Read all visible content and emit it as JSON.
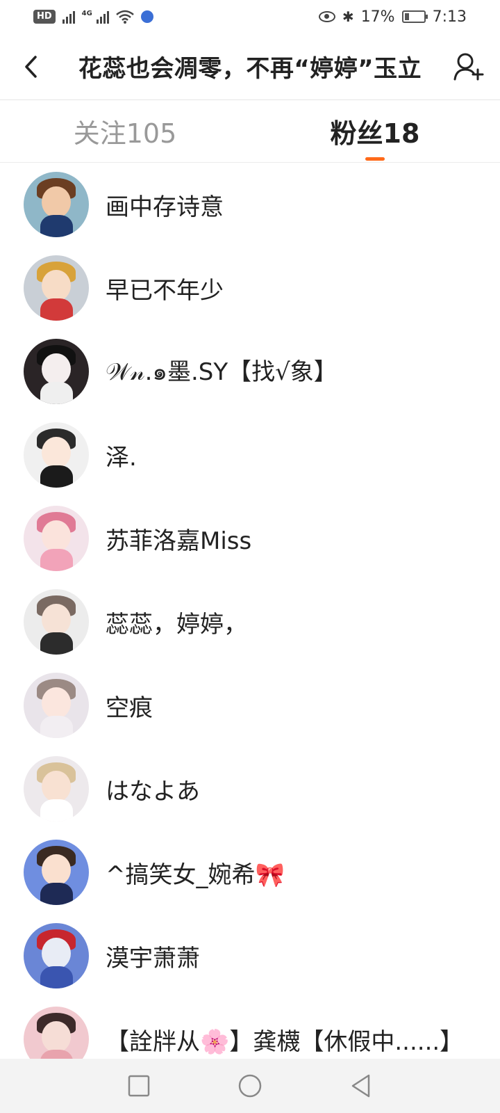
{
  "status_bar": {
    "hd_label": "HD",
    "net_label": "4G",
    "battery_percent": "17%",
    "time": "7:13"
  },
  "header": {
    "title": "花蕊也会凋零，不再“婷婷”玉立"
  },
  "tabs": [
    {
      "label": "关注105",
      "active": false
    },
    {
      "label": "粉丝18",
      "active": true
    }
  ],
  "followers": [
    {
      "name": "画中存诗意"
    },
    {
      "name": "早已不年少"
    },
    {
      "name": "𝒲𝓃.๑墨.SY【找√象】"
    },
    {
      "name": "泽."
    },
    {
      "name": "苏菲洛嘉Miss"
    },
    {
      "name": "蕊蕊，婷婷，"
    },
    {
      "name": "空痕"
    },
    {
      "name": "はなよあ"
    },
    {
      "name": "^搞笑女_婉希🎀"
    },
    {
      "name": "漠宇萧萧"
    },
    {
      "name": "【詮牉从🌸】龚櫗【休假中......】"
    }
  ],
  "colors": {
    "accent": "#ff6a1a",
    "text_primary": "#222222",
    "text_muted": "#999999"
  }
}
